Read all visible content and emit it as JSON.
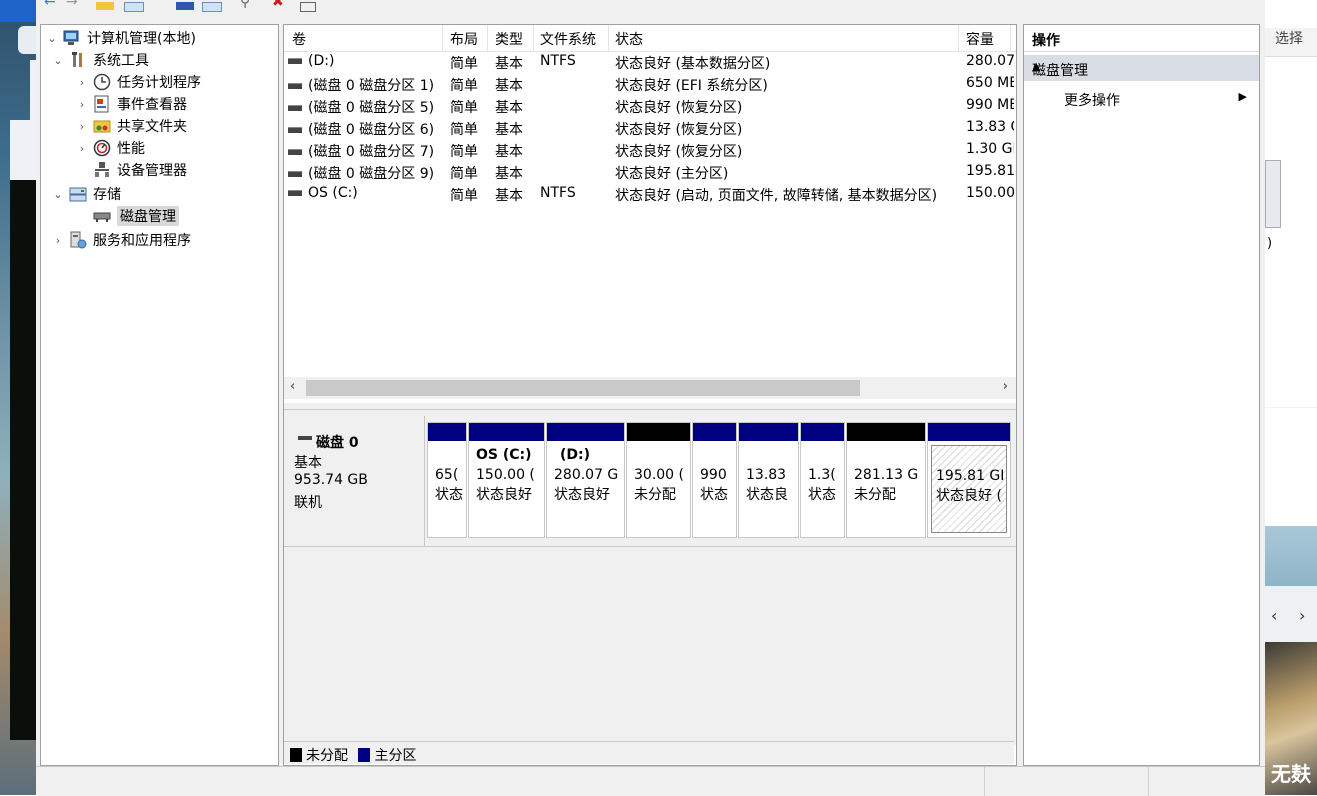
{
  "right_fragment": {
    "select_label": "选择",
    "paren": ")",
    "nav_prev": "‹",
    "nav_next": "›",
    "bottom_text": "无麸"
  },
  "tree": {
    "items": [
      {
        "label": "计算机管理(本地)",
        "icon": "computer-mgmt-icon",
        "expander": "⌄"
      },
      {
        "label": "系统工具",
        "icon": "tools-icon",
        "expander": "⌄"
      },
      {
        "label": "任务计划程序",
        "icon": "clock-icon",
        "expander": "›"
      },
      {
        "label": "事件查看器",
        "icon": "event-viewer-icon",
        "expander": "›"
      },
      {
        "label": "共享文件夹",
        "icon": "shared-folder-icon",
        "expander": "›"
      },
      {
        "label": "性能",
        "icon": "performance-icon",
        "expander": "›"
      },
      {
        "label": "设备管理器",
        "icon": "device-manager-icon",
        "expander": ""
      },
      {
        "label": "存储",
        "icon": "storage-icon",
        "expander": "⌄"
      },
      {
        "label": "磁盘管理",
        "icon": "disk-mgmt-icon",
        "expander": ""
      },
      {
        "label": "服务和应用程序",
        "icon": "services-icon",
        "expander": "›"
      }
    ]
  },
  "volumes": {
    "headers": {
      "volume": "卷",
      "layout": "布局",
      "type": "类型",
      "fs": "文件系统",
      "status": "状态",
      "capacity": "容量"
    },
    "rows": [
      {
        "volume": "(D:)",
        "layout": "简单",
        "type": "基本",
        "fs": "NTFS",
        "status": "状态良好 (基本数据分区)",
        "capacity": "280.07"
      },
      {
        "volume": "(磁盘 0 磁盘分区 1)",
        "layout": "简单",
        "type": "基本",
        "fs": "",
        "status": "状态良好 (EFI 系统分区)",
        "capacity": "650 ME"
      },
      {
        "volume": "(磁盘 0 磁盘分区 5)",
        "layout": "简单",
        "type": "基本",
        "fs": "",
        "status": "状态良好 (恢复分区)",
        "capacity": "990 ME"
      },
      {
        "volume": "(磁盘 0 磁盘分区 6)",
        "layout": "简单",
        "type": "基本",
        "fs": "",
        "status": "状态良好 (恢复分区)",
        "capacity": "13.83 G"
      },
      {
        "volume": "(磁盘 0 磁盘分区 7)",
        "layout": "简单",
        "type": "基本",
        "fs": "",
        "status": "状态良好 (恢复分区)",
        "capacity": "1.30 GE"
      },
      {
        "volume": "(磁盘 0 磁盘分区 9)",
        "layout": "简单",
        "type": "基本",
        "fs": "",
        "status": "状态良好 (主分区)",
        "capacity": "195.81"
      },
      {
        "volume": "OS (C:)",
        "layout": "简单",
        "type": "基本",
        "fs": "NTFS",
        "status": "状态良好 (启动, 页面文件, 故障转储, 基本数据分区)",
        "capacity": "150.00"
      }
    ],
    "scroll_left": "‹",
    "scroll_right": "›"
  },
  "disk": {
    "name": "磁盘 0",
    "type": "基本",
    "size": "953.74 GB",
    "state": "联机",
    "partitions": [
      {
        "title": "",
        "line1": "65(",
        "line2": "状态",
        "kind": "primary"
      },
      {
        "title": "OS (C:)",
        "line1": "150.00 (",
        "line2": "状态良好",
        "kind": "primary"
      },
      {
        "title": "(D:)",
        "line1": "280.07 G",
        "line2": "状态良好",
        "kind": "primary"
      },
      {
        "title": "",
        "line1": "30.00 (",
        "line2": "未分配",
        "kind": "unallocated"
      },
      {
        "title": "",
        "line1": "990",
        "line2": "状态",
        "kind": "primary"
      },
      {
        "title": "",
        "line1": "13.83",
        "line2": "状态良",
        "kind": "primary"
      },
      {
        "title": "",
        "line1": "1.3(",
        "line2": "状态",
        "kind": "primary"
      },
      {
        "title": "",
        "line1": "281.13 G",
        "line2": "未分配",
        "kind": "unallocated"
      },
      {
        "title": "",
        "line1": "195.81 GI",
        "line2": "状态良好 (",
        "kind": "primary"
      }
    ]
  },
  "legend": {
    "unallocated": "未分配",
    "primary": "主分区"
  },
  "colors": {
    "primary": "#000080",
    "unallocated": "#000000"
  },
  "actions": {
    "header": "操作",
    "section": "磁盘管理",
    "more": "更多操作"
  }
}
